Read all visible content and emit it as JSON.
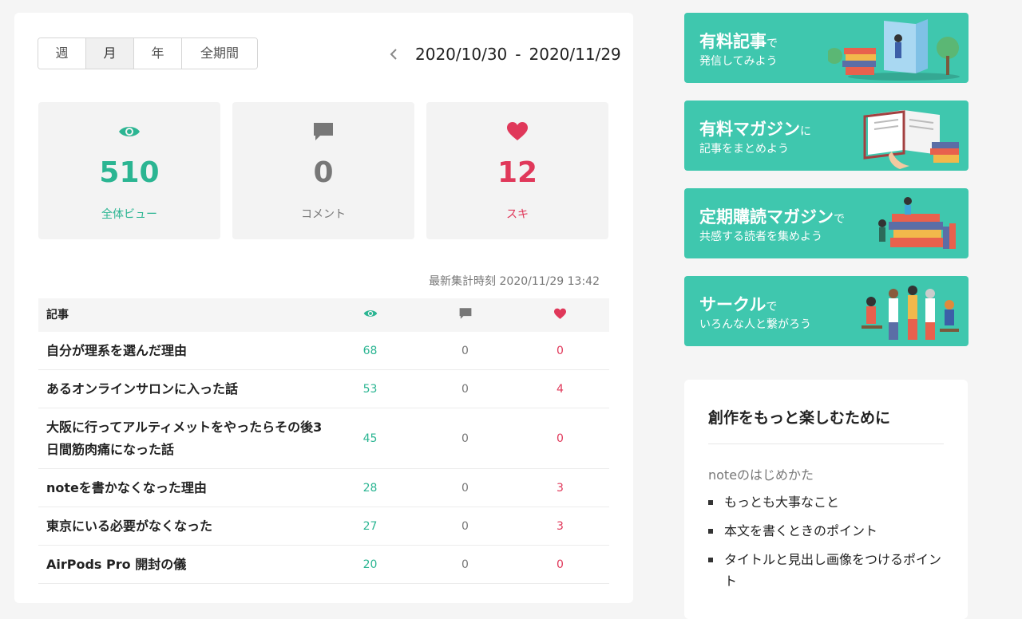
{
  "period_tabs": [
    {
      "label": "週",
      "active": false
    },
    {
      "label": "月",
      "active": true
    },
    {
      "label": "年",
      "active": false
    },
    {
      "label": "全期間",
      "active": false
    }
  ],
  "date_range": {
    "start": "2020/10/30",
    "separator": "-",
    "end": "2020/11/29"
  },
  "stats": {
    "views": {
      "value": "510",
      "label": "全体ビュー",
      "icon": "eye-icon",
      "color": "#2bb592"
    },
    "comments": {
      "value": "0",
      "label": "コメント",
      "icon": "comment-icon",
      "color": "#777777"
    },
    "likes": {
      "value": "12",
      "label": "スキ",
      "icon": "heart-icon",
      "color": "#e0385a"
    }
  },
  "updated_at": "最新集計時刻 2020/11/29 13:42",
  "table": {
    "header": {
      "title": "記事"
    },
    "rows": [
      {
        "title": "自分が理系を選んだ理由",
        "views": "68",
        "comments": "0",
        "likes": "0"
      },
      {
        "title": "あるオンラインサロンに入った話",
        "views": "53",
        "comments": "0",
        "likes": "4"
      },
      {
        "title": "大阪に行ってアルティメットをやったらその後3日間筋肉痛になった話",
        "views": "45",
        "comments": "0",
        "likes": "0"
      },
      {
        "title": "noteを書かなくなった理由",
        "views": "28",
        "comments": "0",
        "likes": "3"
      },
      {
        "title": "東京にいる必要がなくなった",
        "views": "27",
        "comments": "0",
        "likes": "3"
      },
      {
        "title": "AirPods Pro 開封の儀",
        "views": "20",
        "comments": "0",
        "likes": "0"
      }
    ]
  },
  "banners": [
    {
      "title": "有料記事",
      "suffix": "で",
      "subtitle": "発信してみよう"
    },
    {
      "title": "有料マガジン",
      "suffix": "に",
      "subtitle": "記事をまとめよう"
    },
    {
      "title": "定期購読マガジン",
      "suffix": "で",
      "subtitle": "共感する読者を集めよう"
    },
    {
      "title": "サークル",
      "suffix": "で",
      "subtitle": "いろんな人と繋がろう"
    }
  ],
  "guide": {
    "title": "創作をもっと楽しむために",
    "subtitle": "noteのはじめかた",
    "items": [
      "もっとも大事なこと",
      "本文を書くときのポイント",
      "タイトルと見出し画像をつけるポイント"
    ]
  },
  "colors": {
    "accent": "#2bb592",
    "like": "#e0385a",
    "banner": "#3fc7ae"
  }
}
